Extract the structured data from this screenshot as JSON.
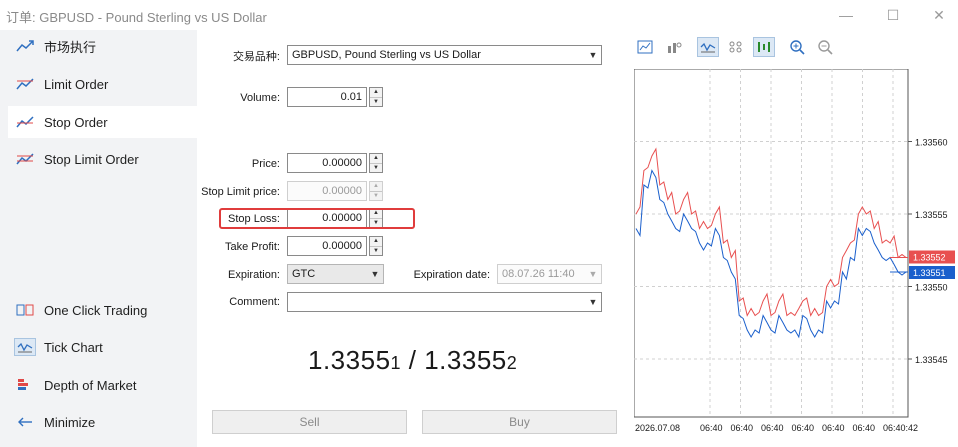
{
  "window": {
    "title": "订单: GBPUSD - Pound Sterling vs US Dollar",
    "minimize_glyph": "—",
    "maximize_glyph": "☐",
    "close_glyph": "✕"
  },
  "sidebar": {
    "items": [
      {
        "label": "市场执行",
        "icon": "market-execution-icon"
      },
      {
        "label": "Limit Order",
        "icon": "limit-order-icon"
      },
      {
        "label": "Stop Order",
        "icon": "stop-order-icon"
      },
      {
        "label": "Stop Limit Order",
        "icon": "stop-limit-order-icon"
      },
      {
        "label": "One Click Trading",
        "icon": "one-click-icon"
      },
      {
        "label": "Tick Chart",
        "icon": "tick-chart-icon"
      },
      {
        "label": "Depth of Market",
        "icon": "depth-icon"
      },
      {
        "label": "Minimize",
        "icon": "arrow-left-icon"
      }
    ]
  },
  "form": {
    "symbol_label": "交易品种:",
    "symbol_value": "GBPUSD, Pound Sterling vs US Dollar",
    "volume_label": "Volume:",
    "volume_value": "0.01",
    "price_label": "Price:",
    "price_value": "0.00000",
    "stop_limit_label": "Stop Limit price:",
    "stop_limit_value": "0.00000",
    "stop_loss_label": "Stop Loss:",
    "stop_loss_value": "0.00000",
    "take_profit_label": "Take Profit:",
    "take_profit_value": "0.00000",
    "expiration_label": "Expiration:",
    "expiration_value": "GTC",
    "expiration_date_label": "Expiration date:",
    "expiration_date_value": "08.07.26 11:40",
    "comment_label": "Comment:",
    "comment_value": ""
  },
  "quote": {
    "bid_main": "1.3355",
    "bid_small": "1",
    "separator": " / ",
    "ask_main": "1.3355",
    "ask_small": "2"
  },
  "buttons": {
    "sell": "Sell",
    "buy": "Buy"
  },
  "colors": {
    "ask_line": "#e85050",
    "bid_line": "#1a5fcc",
    "highlight": "#e03c3c"
  },
  "chart_data": {
    "type": "line",
    "y_ticks": [
      "1.33560",
      "1.33555",
      "1.33550",
      "1.33545"
    ],
    "x_ticks": [
      "2026.07.08",
      "06:40",
      "06:40",
      "06:40",
      "06:40",
      "06:40",
      "06:40",
      "06:40:42"
    ],
    "ask_label": "1.33552",
    "bid_label": "1.33551",
    "ylim": [
      1.33541,
      1.33565
    ],
    "series": [
      {
        "values": [
          1.33555,
          1.33558,
          1.33559,
          1.33557,
          1.33556,
          1.33555,
          1.33556,
          1.33555,
          1.33554,
          1.33554,
          1.33555,
          1.33553,
          1.33552,
          1.33549,
          1.33548,
          1.33548,
          1.33549,
          1.33548,
          1.33549,
          1.33548,
          1.33548,
          1.33549,
          1.33548,
          1.33548,
          1.3355,
          1.3355,
          1.33552,
          1.33553,
          1.33555,
          1.33555,
          1.33554,
          1.33553,
          1.33553,
          1.33552,
          1.33552
        ]
      },
      {
        "values": [
          1.33554,
          1.33557,
          1.33558,
          1.33556,
          1.33555,
          1.33554,
          1.33555,
          1.33554,
          1.33553,
          1.33553,
          1.33554,
          1.33552,
          1.33551,
          1.33548,
          1.33547,
          1.33547,
          1.33548,
          1.33547,
          1.33548,
          1.33547,
          1.33547,
          1.33548,
          1.33547,
          1.33547,
          1.33549,
          1.33549,
          1.33551,
          1.33552,
          1.33554,
          1.33554,
          1.33553,
          1.33552,
          1.33552,
          1.33551,
          1.33551
        ]
      }
    ]
  }
}
